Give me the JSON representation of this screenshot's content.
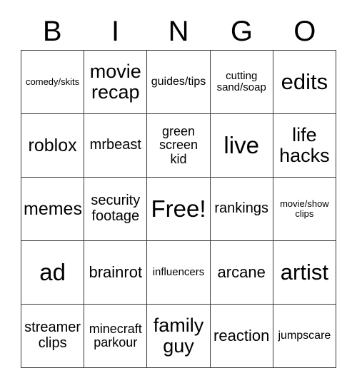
{
  "header": {
    "letters": [
      "B",
      "I",
      "N",
      "G",
      "O"
    ]
  },
  "grid": {
    "columns": 5,
    "rows": 5,
    "cells": [
      {
        "text": "comedy/skits",
        "size": "fs-xs"
      },
      {
        "text": "movie\nrecap",
        "size": "fs-2xl"
      },
      {
        "text": "guides/tips",
        "size": "fs-sm"
      },
      {
        "text": "cutting\nsand/soap",
        "size": "fs-s"
      },
      {
        "text": "edits",
        "size": "fs-3xl"
      },
      {
        "text": "roblox",
        "size": "fs-xl"
      },
      {
        "text": "mrbeast",
        "size": "fs-ml"
      },
      {
        "text": "green\nscreen\nkid",
        "size": "fs-m"
      },
      {
        "text": "live",
        "size": "fs-4xl"
      },
      {
        "text": "life\nhacks",
        "size": "fs-2xl"
      },
      {
        "text": "memes",
        "size": "fs-xl"
      },
      {
        "text": "security\nfootage",
        "size": "fs-ml"
      },
      {
        "text": "Free!",
        "size": "fs-4xl"
      },
      {
        "text": "rankings",
        "size": "fs-ml"
      },
      {
        "text": "movie/show\nclips",
        "size": "fs-xs"
      },
      {
        "text": "ad",
        "size": "fs-4xl"
      },
      {
        "text": "brainrot",
        "size": "fs-l"
      },
      {
        "text": "influencers",
        "size": "fs-s"
      },
      {
        "text": "arcane",
        "size": "fs-l"
      },
      {
        "text": "artist",
        "size": "fs-3xl"
      },
      {
        "text": "streamer\nclips",
        "size": "fs-ml"
      },
      {
        "text": "minecraft\nparkour",
        "size": "fs-m"
      },
      {
        "text": "family\nguy",
        "size": "fs-2xl"
      },
      {
        "text": "reaction",
        "size": "fs-l"
      },
      {
        "text": "jumpscare",
        "size": "fs-sm"
      }
    ]
  },
  "colors": {
    "background": "#ffffff",
    "text": "#000000",
    "gridline": "#3a3a3a"
  }
}
